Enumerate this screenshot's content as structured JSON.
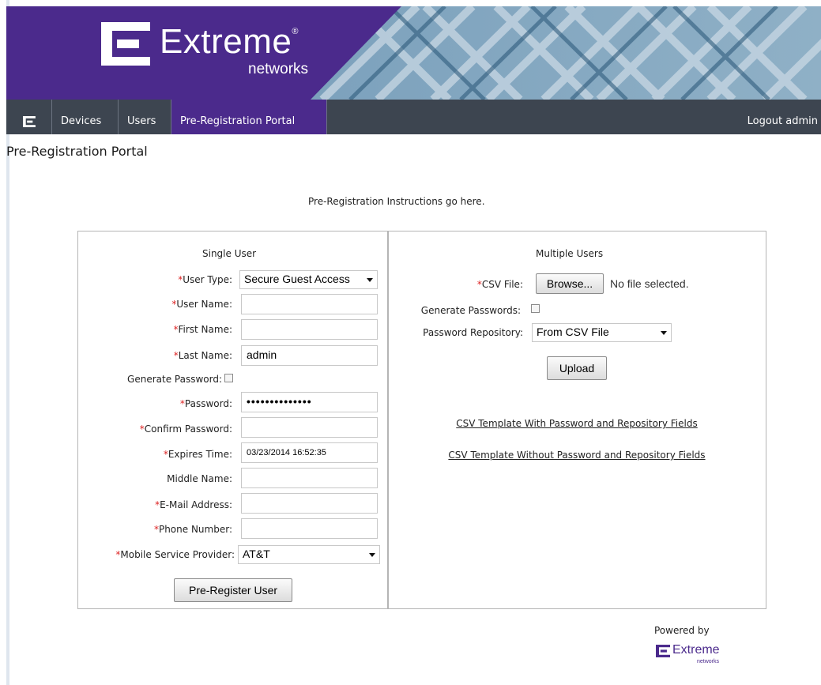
{
  "brand": {
    "name": "Extreme",
    "sub": "networks",
    "registered": "®"
  },
  "nav": {
    "items": [
      {
        "label": "Devices"
      },
      {
        "label": "Users"
      },
      {
        "label": "Pre-Registration Portal"
      }
    ],
    "logout": "Logout admin"
  },
  "page": {
    "title": "Pre-Registration Portal",
    "instructions": "Pre-Registration Instructions go here."
  },
  "single": {
    "title": "Single User",
    "required_mark": "*",
    "user_type": {
      "label": "User Type:",
      "value": "Secure Guest Access"
    },
    "user_name": {
      "label": "User Name:",
      "value": ""
    },
    "first_name": {
      "label": "First Name:",
      "value": ""
    },
    "last_name": {
      "label": "Last Name:",
      "value": "admin"
    },
    "generate_password": {
      "label": "Generate Password:",
      "checked": false
    },
    "password": {
      "label": "Password:",
      "value": "••••••••••••••"
    },
    "confirm_password": {
      "label": "Confirm Password:",
      "value": ""
    },
    "expires_time": {
      "label": "Expires Time:",
      "value": "03/23/2014 16:52:35"
    },
    "middle_name": {
      "label": "Middle Name:",
      "value": ""
    },
    "email": {
      "label": "E-Mail Address:",
      "value": ""
    },
    "phone": {
      "label": "Phone Number:",
      "value": ""
    },
    "provider": {
      "label": "Mobile Service Provider:",
      "value": "AT&T"
    },
    "submit": "Pre-Register User"
  },
  "multiple": {
    "title": "Multiple Users",
    "csv_file": {
      "label": "CSV File:",
      "button": "Browse...",
      "status": "No file selected."
    },
    "generate_passwords": {
      "label": "Generate Passwords:",
      "checked": false
    },
    "password_repository": {
      "label": "Password Repository:",
      "value": "From CSV File"
    },
    "upload": "Upload",
    "link_with": "CSV Template With Password and Repository Fields",
    "link_without": "CSV Template Without Password and Repository Fields"
  },
  "footer": {
    "powered_by": "Powered by",
    "logo_name": "Extreme",
    "logo_sub": "networks"
  },
  "colors": {
    "brand_purple": "#4b2a8c",
    "nav_bg": "#3d4550",
    "required": "#d22222"
  }
}
